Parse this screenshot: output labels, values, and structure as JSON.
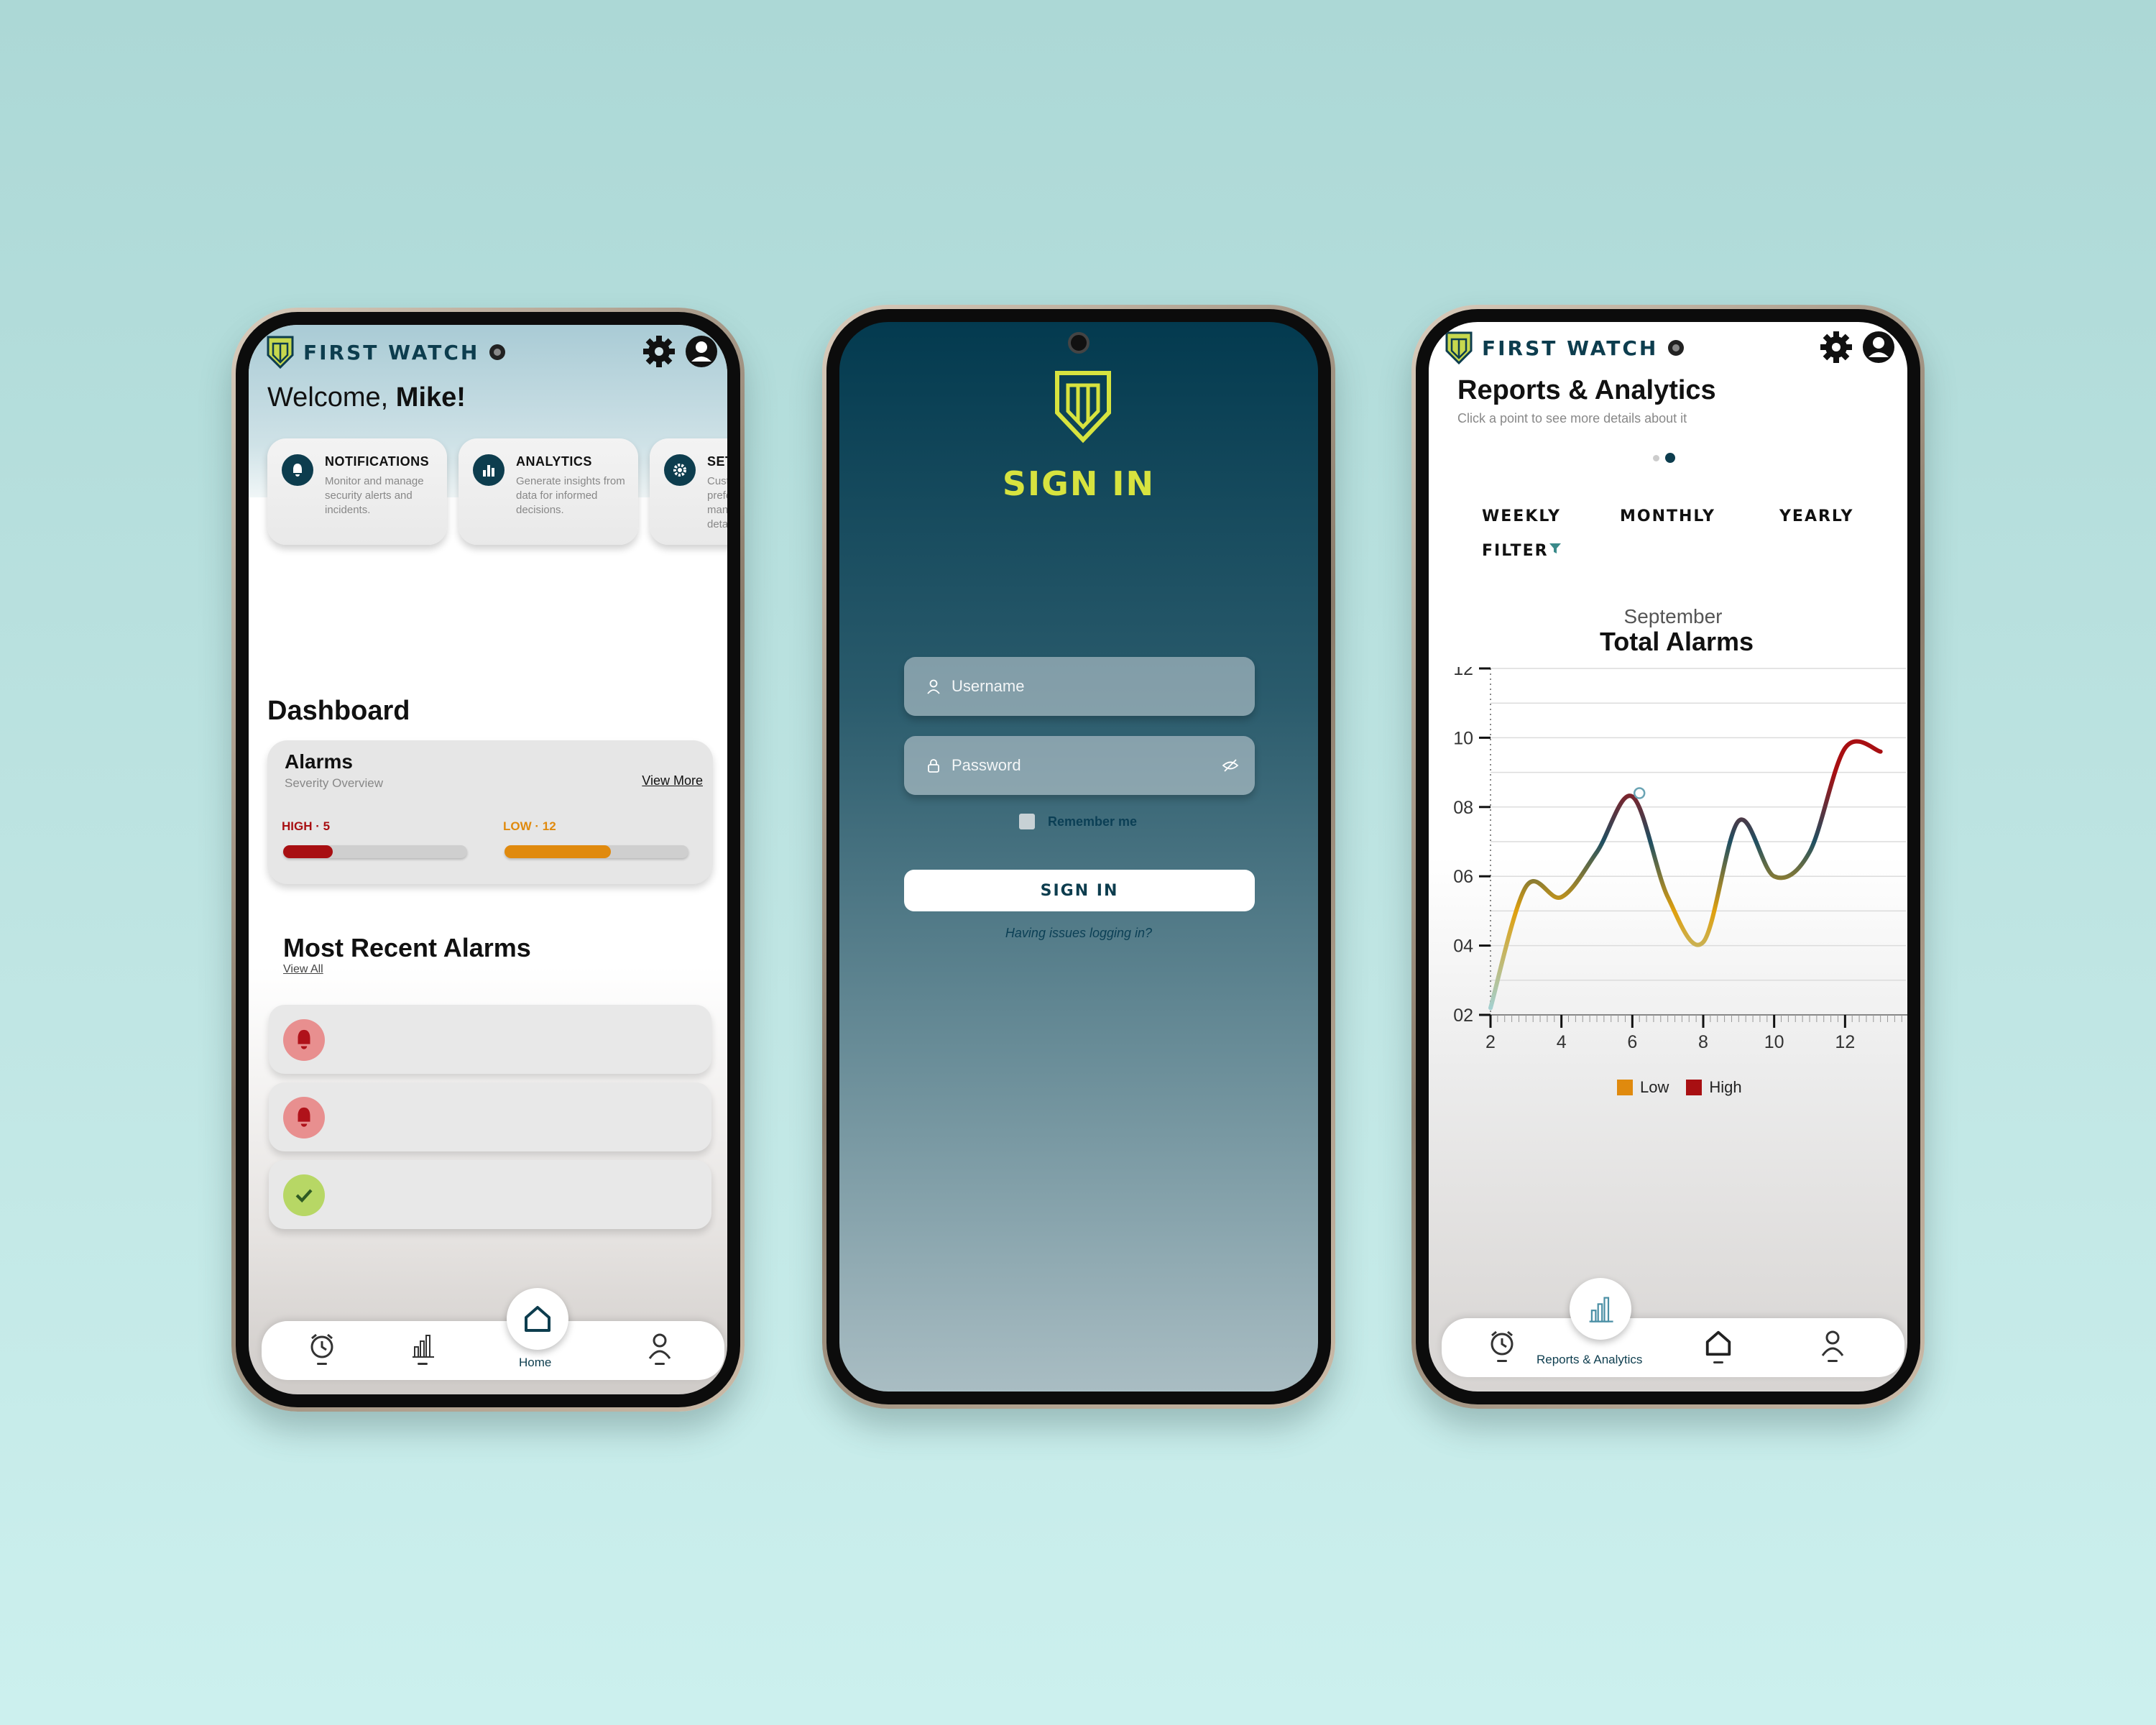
{
  "brand": {
    "name": "FIRST WATCH"
  },
  "colors": {
    "accent": "#d7e33f",
    "brand": "#0d3d4e",
    "high": "#a80f12",
    "low": "#e08a0e",
    "ok": "#b7d765"
  },
  "home": {
    "welcome_prefix": "Welcome, ",
    "welcome_name": "Mike!",
    "features": [
      {
        "title": "NOTIFICATIONS",
        "desc": "Monitor and manage security alerts and incidents.",
        "icon": "bell-icon"
      },
      {
        "title": "ANALYTICS",
        "desc": "Generate insights from data for informed decisions.",
        "icon": "bar-chart-icon"
      },
      {
        "title": "SETTI",
        "desc": "Custo prefe mana details",
        "icon": "gear-icon"
      }
    ],
    "dashboard_title": "Dashboard",
    "alarms": {
      "title": "Alarms",
      "subtitle": "Severity Overview",
      "view_more": "View More",
      "high": {
        "label": "HIGH",
        "value": "5",
        "fill": 0.27
      },
      "low": {
        "label": "LOW",
        "value": "12",
        "fill": 0.58
      }
    },
    "recent": {
      "title": "Most Recent Alarms",
      "view_all": "View All",
      "items": [
        {
          "status": "alarm",
          "icon": "bell-icon"
        },
        {
          "status": "alarm",
          "icon": "bell-icon"
        },
        {
          "status": "resolved",
          "icon": "check-icon"
        }
      ]
    },
    "nav": {
      "active_label": "Home"
    }
  },
  "login": {
    "title": "SIGN IN",
    "username_placeholder": "Username",
    "password_placeholder": "Password",
    "remember": "Remember me",
    "button": "SIGN IN",
    "issue_link": "Having issues logging in?"
  },
  "reports": {
    "title": "Reports & Analytics",
    "subtitle": "Click a point to see more details about it",
    "tabs": [
      "WEEKLY",
      "MONTHLY",
      "YEARLY"
    ],
    "filter": "FILTER",
    "nav": {
      "active_label": "Reports & Analytics"
    }
  },
  "chart_data": {
    "type": "line",
    "title": "Total Alarms",
    "subtitle": "September",
    "x": [
      2,
      3,
      4,
      5,
      6,
      7,
      8,
      9,
      10,
      11,
      12,
      13
    ],
    "y": [
      2.2,
      5.7,
      5.4,
      6.7,
      8.3,
      5.4,
      4.1,
      7.6,
      6.0,
      6.7,
      9.7,
      9.6
    ],
    "highlight_point": {
      "x": 6.2,
      "y": 8.4
    },
    "xticks": [
      "2",
      "4",
      "6",
      "8",
      "10",
      "12"
    ],
    "yticks": [
      "02",
      "04",
      "06",
      "08",
      "10",
      "12"
    ],
    "xlim": [
      2,
      14
    ],
    "ylim": [
      2,
      12
    ],
    "legend": [
      "Low",
      "High"
    ],
    "legend_position": "bottom-center",
    "grid": true,
    "colors": {
      "Low": "#e08a0e",
      "High": "#a80f12"
    }
  }
}
